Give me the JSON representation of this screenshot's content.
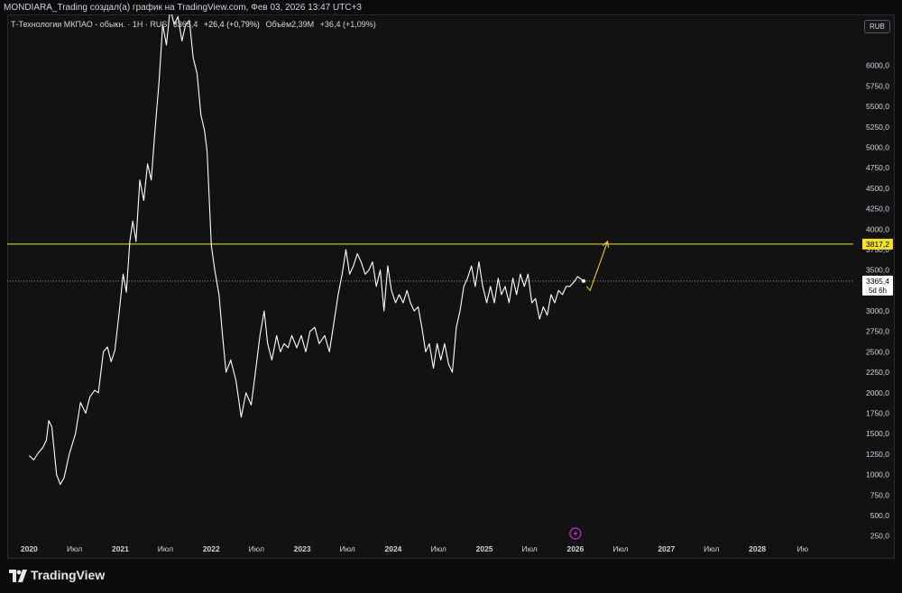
{
  "header": {
    "attribution": "MONDIARA_Trading создал(а) график на TradingView.com, Фев 03, 2026 13:47 UTC+3"
  },
  "legend": {
    "symbol": "Т-Технологии МКПАО - обыкн. · 1Н · RUS",
    "last": "3365,4",
    "change": "+26,4 (+0,79%)",
    "volume_label": "Объём",
    "volume": "2,39M",
    "volume_change": "+36,4 (+1,09%)"
  },
  "currency_button": "RUB",
  "brand": "TradingView",
  "colors": {
    "background": "#121212",
    "price_line": "#ffffff",
    "level_line": "#f0e130",
    "projection": "#e8c44a",
    "axis_text": "#d1d4dc",
    "current_badge_bg": "#ffffff",
    "level_badge_bg": "#f0e130",
    "alert_icon": "#c42bd6"
  },
  "chart_data": {
    "type": "line",
    "series": [
      {
        "values": [
          [
            "2020-01-01",
            1230
          ],
          [
            "2020-01-20",
            1180
          ],
          [
            "2020-02-05",
            1260
          ],
          [
            "2020-02-25",
            1330
          ],
          [
            "2020-03-10",
            1420
          ],
          [
            "2020-03-20",
            1660
          ],
          [
            "2020-04-01",
            1580
          ],
          [
            "2020-04-20",
            1000
          ],
          [
            "2020-05-05",
            880
          ],
          [
            "2020-05-20",
            960
          ],
          [
            "2020-06-10",
            1250
          ],
          [
            "2020-07-05",
            1500
          ],
          [
            "2020-07-25",
            1880
          ],
          [
            "2020-08-15",
            1750
          ],
          [
            "2020-09-01",
            1950
          ],
          [
            "2020-09-20",
            2030
          ],
          [
            "2020-10-05",
            2000
          ],
          [
            "2020-10-25",
            2500
          ],
          [
            "2020-11-10",
            2560
          ],
          [
            "2020-11-25",
            2380
          ],
          [
            "2020-12-10",
            2520
          ],
          [
            "2020-12-28",
            3000
          ],
          [
            "2021-01-12",
            3450
          ],
          [
            "2021-01-25",
            3230
          ],
          [
            "2021-02-08",
            3850
          ],
          [
            "2021-02-20",
            4100
          ],
          [
            "2021-03-05",
            3850
          ],
          [
            "2021-03-20",
            4600
          ],
          [
            "2021-04-05",
            4350
          ],
          [
            "2021-04-20",
            4800
          ],
          [
            "2021-05-05",
            4600
          ],
          [
            "2021-05-20",
            5200
          ],
          [
            "2021-06-05",
            5800
          ],
          [
            "2021-06-20",
            6500
          ],
          [
            "2021-07-05",
            6250
          ],
          [
            "2021-07-20",
            6700
          ],
          [
            "2021-08-05",
            6500
          ],
          [
            "2021-08-20",
            6600
          ],
          [
            "2021-09-05",
            6300
          ],
          [
            "2021-09-20",
            6500
          ],
          [
            "2021-10-05",
            6550
          ],
          [
            "2021-10-20",
            6100
          ],
          [
            "2021-11-05",
            5900
          ],
          [
            "2021-11-20",
            5400
          ],
          [
            "2021-12-05",
            5200
          ],
          [
            "2021-12-15",
            4950
          ],
          [
            "2022-01-01",
            3800
          ],
          [
            "2022-01-15",
            3500
          ],
          [
            "2022-02-01",
            3200
          ],
          [
            "2022-02-15",
            2700
          ],
          [
            "2022-03-01",
            2250
          ],
          [
            "2022-03-20",
            2400
          ],
          [
            "2022-04-10",
            2150
          ],
          [
            "2022-05-01",
            1700
          ],
          [
            "2022-05-20",
            2000
          ],
          [
            "2022-06-10",
            1850
          ],
          [
            "2022-06-25",
            2200
          ],
          [
            "2022-07-15",
            2700
          ],
          [
            "2022-08-01",
            3000
          ],
          [
            "2022-08-15",
            2600
          ],
          [
            "2022-09-01",
            2400
          ],
          [
            "2022-09-20",
            2700
          ],
          [
            "2022-10-05",
            2500
          ],
          [
            "2022-10-20",
            2600
          ],
          [
            "2022-11-05",
            2550
          ],
          [
            "2022-11-20",
            2700
          ],
          [
            "2022-12-10",
            2550
          ],
          [
            "2022-12-28",
            2700
          ],
          [
            "2023-01-15",
            2500
          ],
          [
            "2023-02-01",
            2750
          ],
          [
            "2023-02-20",
            2800
          ],
          [
            "2023-03-10",
            2600
          ],
          [
            "2023-04-01",
            2700
          ],
          [
            "2023-04-20",
            2500
          ],
          [
            "2023-05-05",
            2800
          ],
          [
            "2023-05-25",
            3200
          ],
          [
            "2023-06-10",
            3450
          ],
          [
            "2023-06-25",
            3750
          ],
          [
            "2023-07-10",
            3450
          ],
          [
            "2023-07-25",
            3550
          ],
          [
            "2023-08-10",
            3700
          ],
          [
            "2023-08-25",
            3600
          ],
          [
            "2023-09-10",
            3450
          ],
          [
            "2023-09-25",
            3500
          ],
          [
            "2023-10-10",
            3600
          ],
          [
            "2023-10-25",
            3300
          ],
          [
            "2023-11-10",
            3500
          ],
          [
            "2023-11-25",
            3000
          ],
          [
            "2023-12-10",
            3550
          ],
          [
            "2023-12-25",
            3250
          ],
          [
            "2024-01-10",
            3100
          ],
          [
            "2024-01-25",
            3200
          ],
          [
            "2024-02-10",
            3100
          ],
          [
            "2024-02-25",
            3250
          ],
          [
            "2024-03-10",
            3100
          ],
          [
            "2024-03-25",
            3000
          ],
          [
            "2024-04-10",
            3050
          ],
          [
            "2024-04-25",
            2800
          ],
          [
            "2024-05-10",
            2500
          ],
          [
            "2024-05-25",
            2600
          ],
          [
            "2024-06-10",
            2300
          ],
          [
            "2024-06-25",
            2600
          ],
          [
            "2024-07-10",
            2400
          ],
          [
            "2024-07-25",
            2600
          ],
          [
            "2024-08-10",
            2350
          ],
          [
            "2024-08-25",
            2250
          ],
          [
            "2024-09-10",
            2800
          ],
          [
            "2024-09-25",
            3000
          ],
          [
            "2024-10-10",
            3300
          ],
          [
            "2024-10-25",
            3400
          ],
          [
            "2024-11-10",
            3550
          ],
          [
            "2024-11-25",
            3300
          ],
          [
            "2024-12-10",
            3600
          ],
          [
            "2024-12-25",
            3300
          ],
          [
            "2025-01-10",
            3100
          ],
          [
            "2025-01-25",
            3300
          ],
          [
            "2025-02-10",
            3100
          ],
          [
            "2025-02-25",
            3400
          ],
          [
            "2025-03-10",
            3200
          ],
          [
            "2025-03-25",
            3300
          ],
          [
            "2025-04-10",
            3100
          ],
          [
            "2025-04-25",
            3400
          ],
          [
            "2025-05-10",
            3200
          ],
          [
            "2025-05-25",
            3450
          ],
          [
            "2025-06-10",
            3300
          ],
          [
            "2025-06-25",
            3450
          ],
          [
            "2025-07-10",
            3100
          ],
          [
            "2025-07-25",
            3150
          ],
          [
            "2025-08-10",
            2900
          ],
          [
            "2025-08-25",
            3050
          ],
          [
            "2025-09-10",
            2950
          ],
          [
            "2025-09-25",
            3200
          ],
          [
            "2025-10-10",
            3100
          ],
          [
            "2025-10-25",
            3250
          ],
          [
            "2025-11-10",
            3200
          ],
          [
            "2025-11-25",
            3300
          ],
          [
            "2025-12-10",
            3300
          ],
          [
            "2025-12-25",
            3350
          ],
          [
            "2026-01-10",
            3420
          ],
          [
            "2026-02-03",
            3365.4
          ]
        ]
      }
    ],
    "projection": [
      [
        "2026-02-15",
        3300
      ],
      [
        "2026-03-01",
        3250
      ],
      [
        "2026-05-10",
        3850
      ]
    ],
    "horizontal_levels": [
      {
        "value": 3817.2,
        "label": "3817,2"
      }
    ],
    "current_price": {
      "value": 3365.4,
      "label": "3365,4",
      "countdown": "5d 6h"
    },
    "ylim": [
      125,
      6625
    ],
    "xlim": [
      "2019-10-05",
      "2029-01-20"
    ],
    "y_ticks": [
      {
        "v": 250,
        "t": "250,0"
      },
      {
        "v": 500,
        "t": "500,0"
      },
      {
        "v": 750,
        "t": "750,0"
      },
      {
        "v": 1000,
        "t": "1000,0"
      },
      {
        "v": 1250,
        "t": "1250,0"
      },
      {
        "v": 1500,
        "t": "1500,0"
      },
      {
        "v": 1750,
        "t": "1750,0"
      },
      {
        "v": 2000,
        "t": "2000,0"
      },
      {
        "v": 2250,
        "t": "2250,0"
      },
      {
        "v": 2500,
        "t": "2500,0"
      },
      {
        "v": 2750,
        "t": "2750,0"
      },
      {
        "v": 3000,
        "t": "3000,0"
      },
      {
        "v": 3250,
        "t": "3250,0"
      },
      {
        "v": 3500,
        "t": "3500,0"
      },
      {
        "v": 3750,
        "t": "3750,0"
      },
      {
        "v": 4000,
        "t": "4000,0"
      },
      {
        "v": 4250,
        "t": "4250,0"
      },
      {
        "v": 4500,
        "t": "4500,0"
      },
      {
        "v": 4750,
        "t": "4750,0"
      },
      {
        "v": 5000,
        "t": "5000,0"
      },
      {
        "v": 5250,
        "t": "5250,0"
      },
      {
        "v": 5500,
        "t": "5500,0"
      },
      {
        "v": 5750,
        "t": "5750,0"
      },
      {
        "v": 6000,
        "t": "6000,0"
      }
    ],
    "x_ticks": [
      {
        "d": "2020-01-01",
        "t": "2020",
        "bold": true
      },
      {
        "d": "2020-07-01",
        "t": "Июл"
      },
      {
        "d": "2021-01-01",
        "t": "2021",
        "bold": true
      },
      {
        "d": "2021-07-01",
        "t": "Июл"
      },
      {
        "d": "2022-01-01",
        "t": "2022",
        "bold": true
      },
      {
        "d": "2022-07-01",
        "t": "Июл"
      },
      {
        "d": "2023-01-01",
        "t": "2023",
        "bold": true
      },
      {
        "d": "2023-07-01",
        "t": "Июл"
      },
      {
        "d": "2024-01-01",
        "t": "2024",
        "bold": true
      },
      {
        "d": "2024-07-01",
        "t": "Июл"
      },
      {
        "d": "2025-01-01",
        "t": "2025",
        "bold": true
      },
      {
        "d": "2025-07-01",
        "t": "Июл"
      },
      {
        "d": "2026-01-01",
        "t": "2026",
        "bold": true
      },
      {
        "d": "2026-07-01",
        "t": "Июл"
      },
      {
        "d": "2027-01-01",
        "t": "2027",
        "bold": true
      },
      {
        "d": "2027-07-01",
        "t": "Июл"
      },
      {
        "d": "2028-01-01",
        "t": "2028",
        "bold": true
      },
      {
        "d": "2028-07-01",
        "t": "Ию"
      }
    ],
    "grid": false
  }
}
